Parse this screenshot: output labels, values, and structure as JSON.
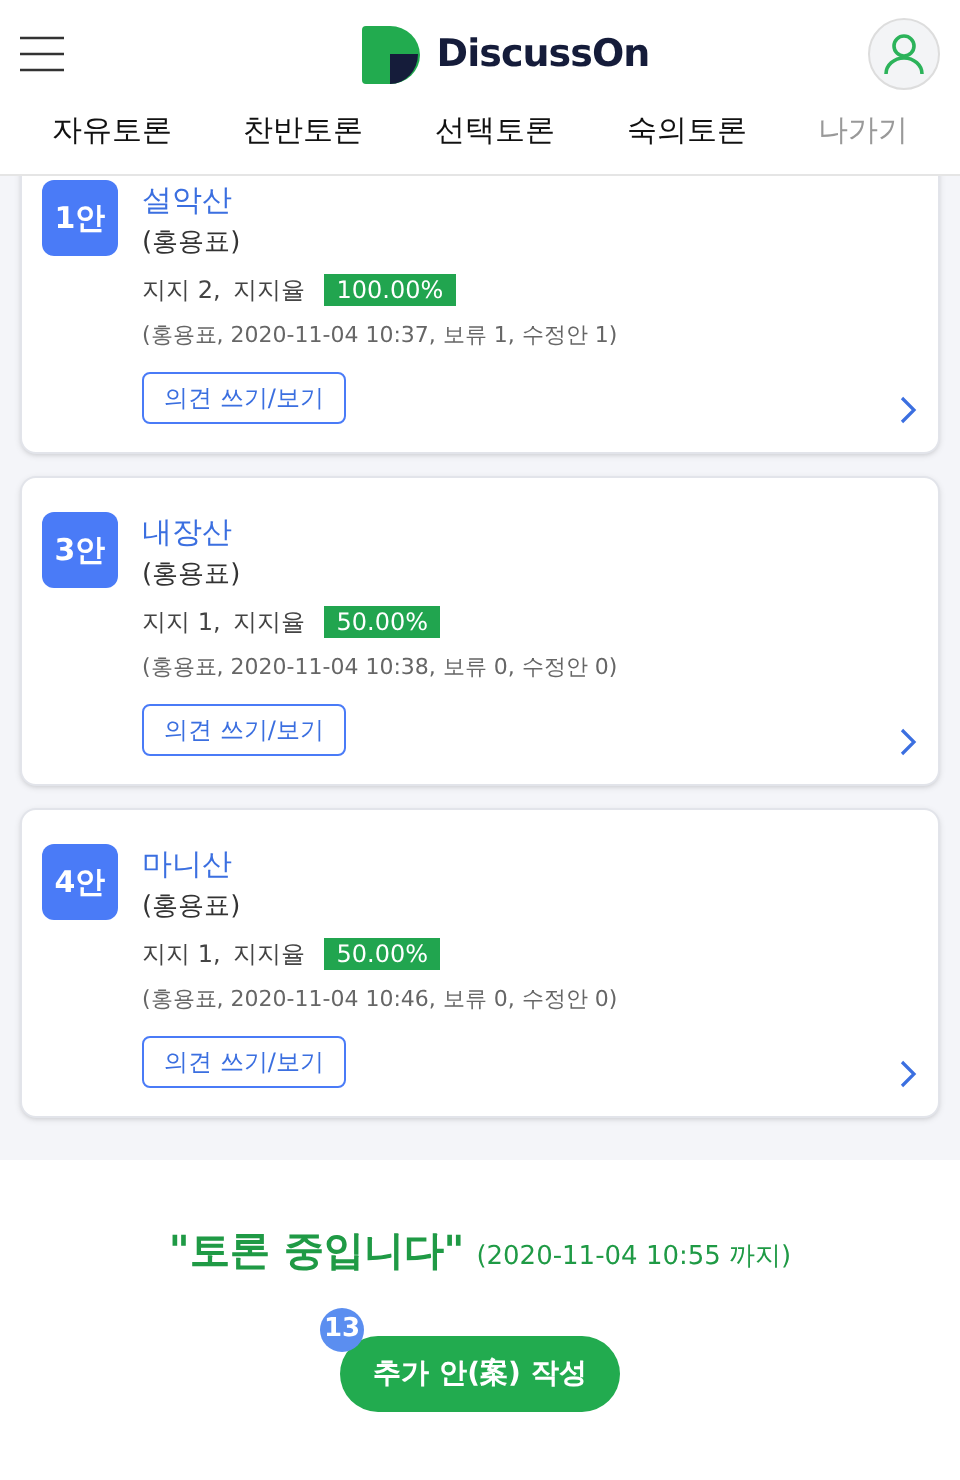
{
  "header": {
    "logo": "DiscussOn"
  },
  "tabs": [
    {
      "label": "자유토론",
      "disabled": false
    },
    {
      "label": "찬반토론",
      "disabled": false
    },
    {
      "label": "선택토론",
      "disabled": false
    },
    {
      "label": "숙의토론",
      "disabled": false
    },
    {
      "label": "나가기",
      "disabled": true
    }
  ],
  "proposals": [
    {
      "number": "1안",
      "title": "설악산",
      "author": "(홍용표)",
      "support": "지지 2,",
      "rate_label": "지지율",
      "rate": "100.00%",
      "meta": "(홍용표, 2020-11-04 10:37, 보류 1, 수정안 1)",
      "button": "의견 쓰기/보기"
    },
    {
      "number": "3안",
      "title": "내장산",
      "author": "(홍용표)",
      "support": "지지 1,",
      "rate_label": "지지율",
      "rate": "50.00%",
      "meta": "(홍용표, 2020-11-04 10:38, 보류 0, 수정안 0)",
      "button": "의견 쓰기/보기"
    },
    {
      "number": "4안",
      "title": "마니산",
      "author": "(홍용표)",
      "support": "지지 1,",
      "rate_label": "지지율",
      "rate": "50.00%",
      "meta": "(홍용표, 2020-11-04 10:46, 보류 0, 수정안 0)",
      "button": "의견 쓰기/보기"
    }
  ],
  "status": {
    "text": "\"토론 중입니다\"",
    "until": "(2020-11-04 10:55 까지)"
  },
  "add_button": {
    "label": "추가 안(案) 작성",
    "badge": "13"
  }
}
